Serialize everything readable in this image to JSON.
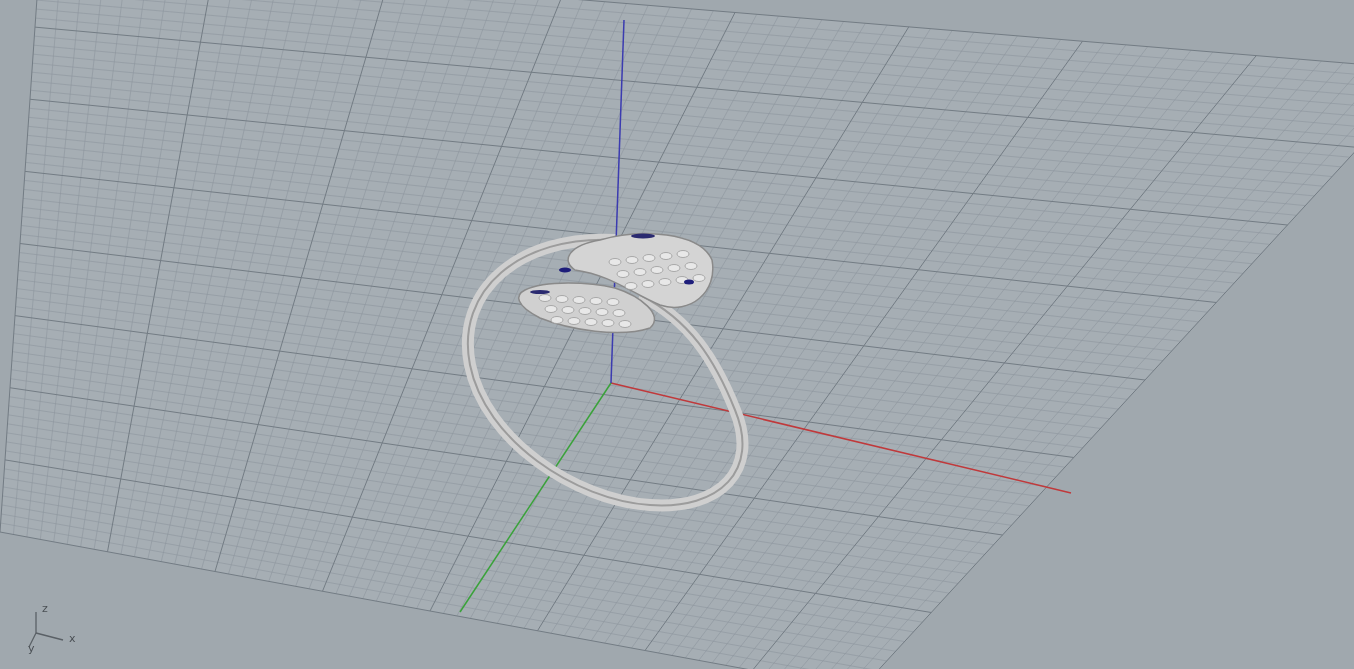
{
  "viewport": {
    "axis_labels": [
      {
        "label": "z"
      },
      {
        "label": "x"
      },
      {
        "label": "y"
      }
    ]
  }
}
